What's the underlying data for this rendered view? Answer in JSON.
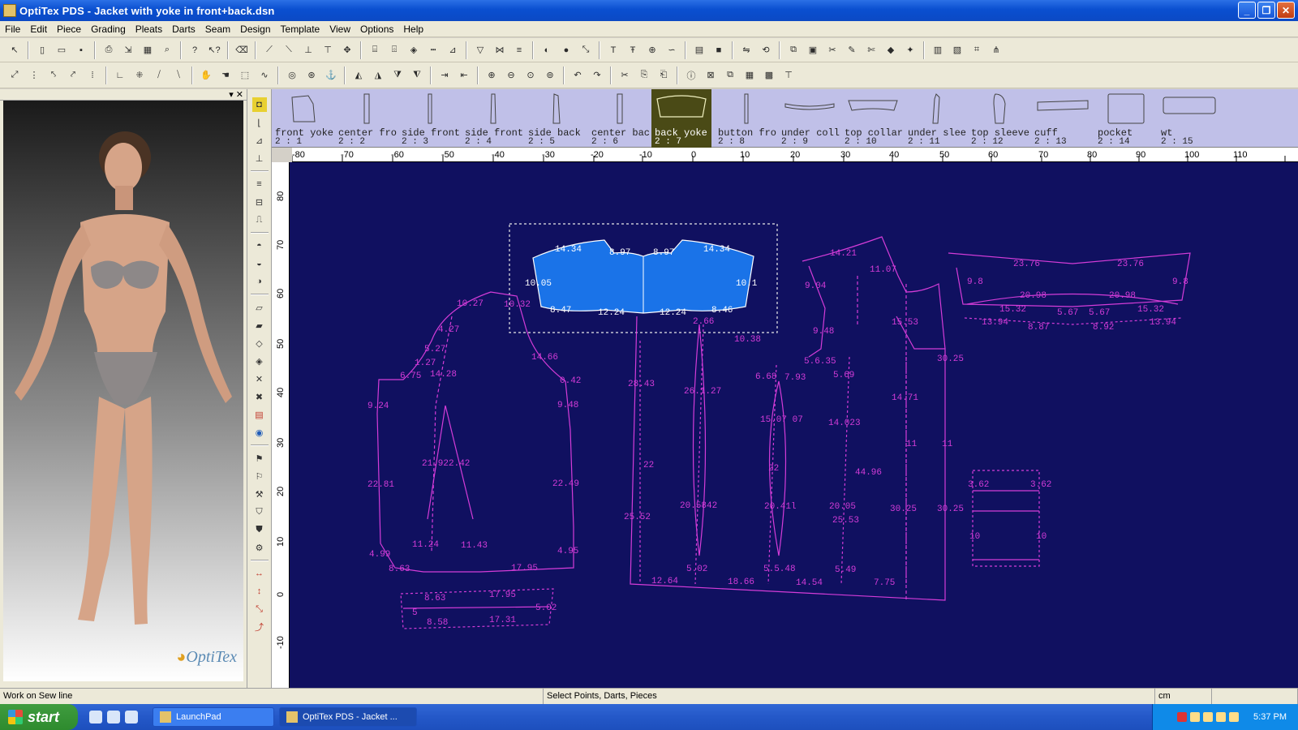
{
  "window": {
    "title": "OptiTex PDS - Jacket with yoke in front+back.dsn"
  },
  "menu": [
    "File",
    "Edit",
    "Piece",
    "Grading",
    "Pleats",
    "Darts",
    "Seam",
    "Design",
    "Template",
    "View",
    "Options",
    "Help"
  ],
  "pieces": [
    {
      "name": "front yoke",
      "num": "2 : 1"
    },
    {
      "name": "center fro",
      "num": "2 : 2"
    },
    {
      "name": "side front",
      "num": "2 : 3"
    },
    {
      "name": "side front",
      "num": "2 : 4"
    },
    {
      "name": "side back",
      "num": "2 : 5"
    },
    {
      "name": "center bac",
      "num": "2 : 6"
    },
    {
      "name": "back yoke",
      "num": "2 : 7",
      "selected": true
    },
    {
      "name": "button fro",
      "num": "2 : 8"
    },
    {
      "name": "under coll",
      "num": "2 : 9"
    },
    {
      "name": "top collar",
      "num": "2 : 10"
    },
    {
      "name": "under slee",
      "num": "2 : 11"
    },
    {
      "name": "top sleeve",
      "num": "2 : 12"
    },
    {
      "name": "cuff",
      "num": "2 : 13"
    },
    {
      "name": "pocket",
      "num": "2 : 14"
    },
    {
      "name": "wt",
      "num": "2 : 15"
    }
  ],
  "ruler": {
    "h_ticks": [
      "-80",
      "-70",
      "-60",
      "-50",
      "-40",
      "-30",
      "-20",
      "-10",
      "0",
      "10",
      "20",
      "30",
      "40",
      "50",
      "60",
      "70",
      "80",
      "90",
      "100",
      "110"
    ],
    "v_ticks": [
      "80",
      "70",
      "60",
      "50",
      "40",
      "30",
      "20",
      "10",
      "0",
      "-10"
    ]
  },
  "canvas": {
    "labels": [
      "14.34",
      "8.97",
      "8.97",
      "14.34",
      "10.05",
      "10.1",
      "8.47",
      "12.24",
      "12.24",
      "8.46",
      "10.27",
      "10.32",
      "14.66",
      "0.42",
      "9.48",
      "22.49",
      "4.95",
      "17.95",
      "5.27",
      "4.27",
      "1.27",
      "6.75",
      "14.28",
      "9.24",
      "22.81",
      "4.99",
      "8.63",
      "21.922.42",
      "11.24",
      "11.43",
      "28.43",
      "22",
      "25.52",
      "12.64",
      "2.66",
      "26.1.27",
      "20.5842",
      "5.02",
      "18.66",
      "15.07 07",
      "22",
      "20.41l",
      "5.5.48",
      "14.54",
      "14.21",
      "11.07",
      "9.04",
      "9.48",
      "10.38",
      "6.68",
      "7.93",
      "5.6.35",
      "5.69",
      "14.023",
      "20.05",
      "25.53",
      "5.49",
      "7.75",
      "15.53",
      "14.71",
      "11",
      "30.25",
      "30.25",
      "11",
      "30.25",
      "44.96",
      "23.76",
      "23.76",
      "9.8",
      "9.8",
      "20.98",
      "20.98",
      "15.32",
      "15.32",
      "5.67",
      "5.67",
      "13.94",
      "13.94",
      "8.87",
      "8.92",
      "3.62",
      "3.62",
      "10",
      "10",
      "8.63",
      "17.95",
      "5",
      "5.02",
      "8.58",
      "17.31"
    ]
  },
  "statusbar": {
    "left": "Work on Sew line",
    "middle": "Select Points, Darts, Pieces",
    "units": "cm"
  },
  "taskbar": {
    "start": "start",
    "items": [
      "LaunchPad",
      "OptiTex PDS - Jacket ..."
    ],
    "clock": "5:37 PM"
  },
  "colors": {
    "canvas_bg": "#101060",
    "pattern_line": "#d43cd8",
    "selected_fill": "#1a73e8",
    "piecebar_bg": "#c0c0e8"
  },
  "logo": {
    "text": "OptiTex"
  }
}
